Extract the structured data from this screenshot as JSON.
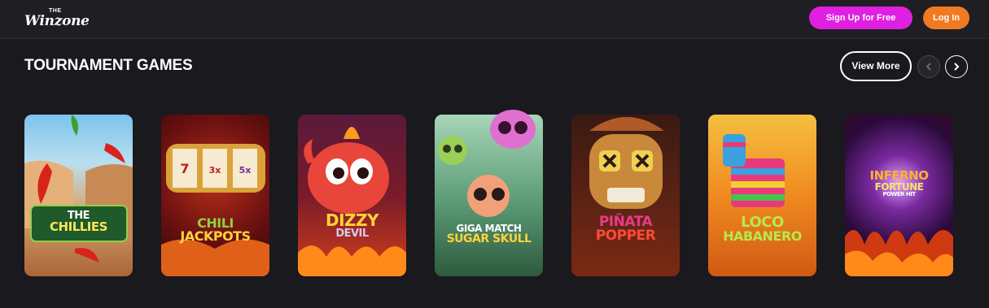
{
  "header": {
    "logo_the": "THE",
    "logo_word": "Winzone",
    "signup_label": "Sign Up for Free",
    "login_label": "Log In"
  },
  "section": {
    "title": "TOURNAMENT GAMES",
    "view_more_label": "View More",
    "prev_icon": "chevron-left-icon",
    "next_icon": "chevron-right-icon"
  },
  "games": [
    {
      "title_line1": "THE",
      "title_line2": "CHILLIES",
      "colors": [
        "#6fb8e6",
        "#c9864a"
      ]
    },
    {
      "title_line1": "CHILI",
      "title_line2": "JACKPOTS",
      "colors": [
        "#8a1c1c",
        "#3a0b0b"
      ]
    },
    {
      "title_line1": "DIZZY",
      "title_line2": "DEVIL",
      "colors": [
        "#6b1a3a",
        "#c0391a"
      ]
    },
    {
      "title_line1": "GIGA MATCH",
      "title_line2": "SUGAR SKULL",
      "colors": [
        "#8fc9a8",
        "#3e7a5a"
      ]
    },
    {
      "title_line1": "PIÑATA",
      "title_line2": "POPPER",
      "colors": [
        "#3a1a10",
        "#7a2a10"
      ]
    },
    {
      "title_line1": "LOCO",
      "title_line2": "HABANERO",
      "colors": [
        "#f0b020",
        "#d05a10"
      ]
    },
    {
      "title_line1": "INFERNO",
      "title_line2": "FORTUNE",
      "title_line3": "POWER HIT",
      "colors": [
        "#2a0a3a",
        "#b02010"
      ]
    }
  ]
}
